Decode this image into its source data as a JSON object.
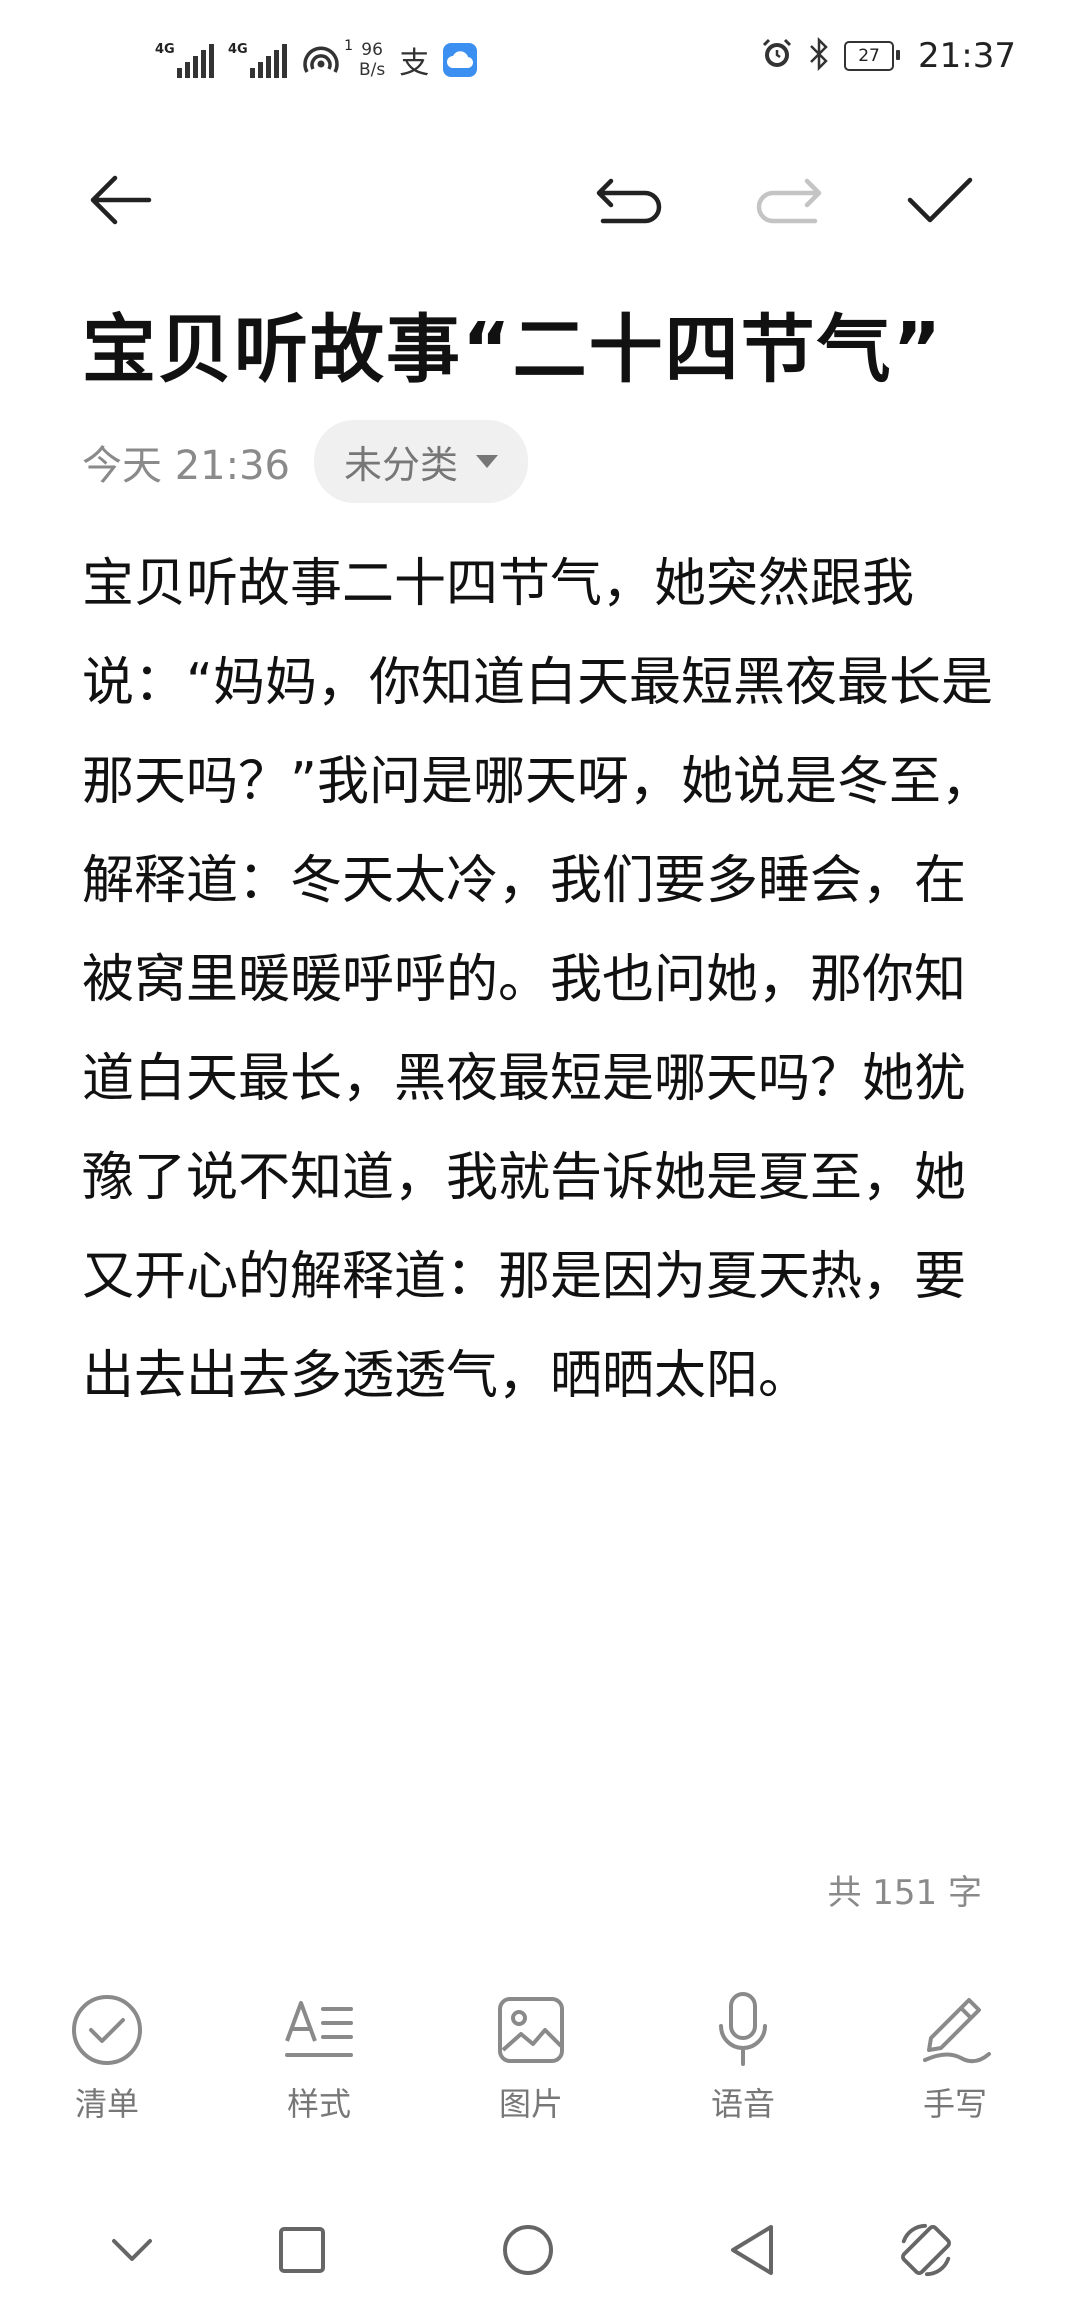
{
  "status_bar": {
    "signal1": "4G",
    "signal2": "4G",
    "hotspot_count": "1",
    "speed_value": "96",
    "speed_unit": "B/s",
    "alipay_glyph": "支",
    "battery": "27",
    "time": "21:37"
  },
  "toolbar": {
    "back_icon": "arrow-left-icon",
    "undo_icon": "undo-icon",
    "redo_icon": "redo-icon",
    "done_icon": "check-icon"
  },
  "note": {
    "title": "宝贝听故事“二十四节气”",
    "date": "今天 21:36",
    "category": "未分类",
    "body": "宝贝听故事二十四节气，她突然跟我说：“妈妈，你知道白天最短黑夜最长是那天吗？”我问是哪天呀，她说是冬至，解释道：冬天太冷，我们要多睡会，在被窝里暖暖呼呼的。我也问她，那你知道白天最长，黑夜最短是哪天吗？她犹豫了说不知道，我就告诉她是夏至，她又开心的解释道：那是因为夏天热，要出去出去多透透气，晒晒太阳。",
    "word_count": "共 151 字"
  },
  "bottom_tools": [
    {
      "label": "清单",
      "icon": "checklist-icon"
    },
    {
      "label": "样式",
      "icon": "text-style-icon"
    },
    {
      "label": "图片",
      "icon": "image-icon"
    },
    {
      "label": "语音",
      "icon": "microphone-icon"
    },
    {
      "label": "手写",
      "icon": "pen-icon"
    }
  ],
  "nav_bar": [
    "collapse-icon",
    "recents-icon",
    "home-icon",
    "back-icon",
    "rotate-icon"
  ]
}
